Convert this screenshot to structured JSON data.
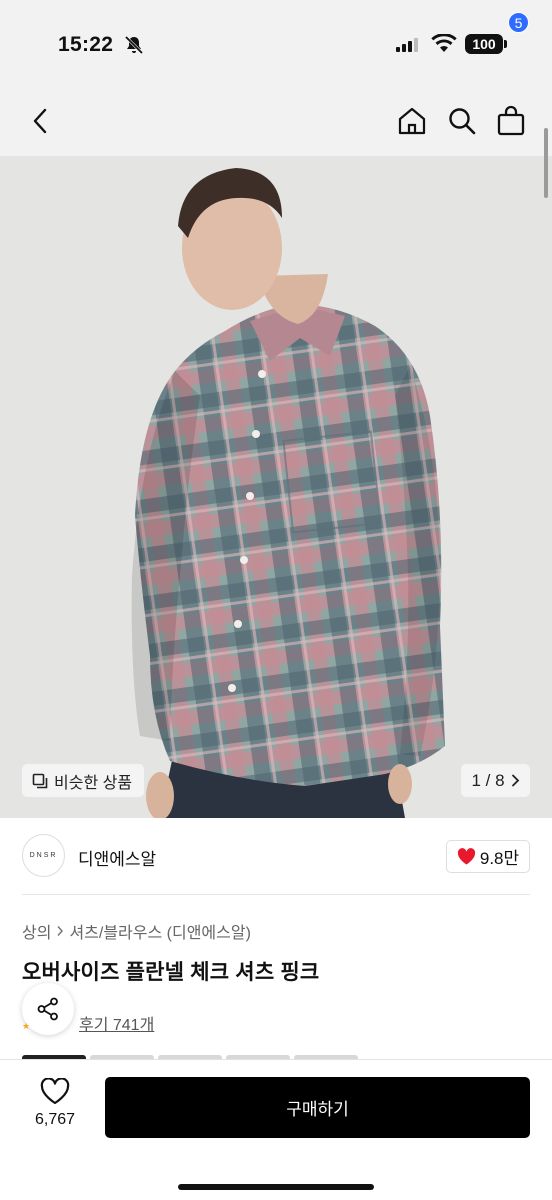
{
  "status_bar": {
    "time": "15:22",
    "battery": "100"
  },
  "nav": {
    "cart_count": "5"
  },
  "gallery": {
    "similar_label": "비슷한 상품",
    "page_indicator": "1 / 8"
  },
  "brand": {
    "logo_text": "DNSR",
    "name": "디앤에스알",
    "likes": "9.8만"
  },
  "product": {
    "breadcrumb": [
      "상의",
      "셔츠/블라우스 (디앤에스알)"
    ],
    "title": "오버사이즈 플란넬 체크 셔츠 핑크",
    "review_text": "후기 741개"
  },
  "bottom_bar": {
    "wish_count": "6,767",
    "buy_label": "구매하기"
  },
  "colors": {
    "accent": "#2f6bff",
    "heart": "#e8192c",
    "buy_button": "#000000"
  }
}
